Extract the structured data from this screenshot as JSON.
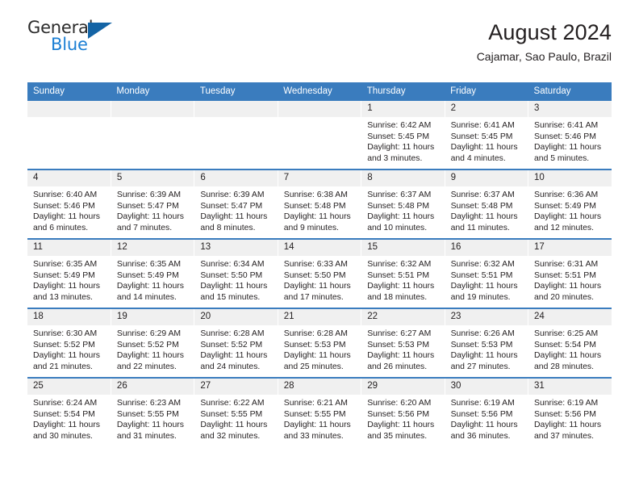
{
  "brand": {
    "name_part1": "General",
    "name_part2": "Blue",
    "triangle_color": "#1464a5",
    "blue": "#1b7fd4"
  },
  "header": {
    "title": "August 2024",
    "subtitle": "Cajamar, Sao Paulo, Brazil"
  },
  "theme": {
    "header_blue": "#3a7cbe",
    "daynum_bg": "#f0f0f0",
    "text": "#231f20"
  },
  "weekdays": [
    "Sunday",
    "Monday",
    "Tuesday",
    "Wednesday",
    "Thursday",
    "Friday",
    "Saturday"
  ],
  "weeks": [
    [
      {
        "day": "",
        "empty": true,
        "sunrise": "",
        "sunset": "",
        "daylight_line1": "",
        "daylight_line2": ""
      },
      {
        "day": "",
        "empty": true,
        "sunrise": "",
        "sunset": "",
        "daylight_line1": "",
        "daylight_line2": ""
      },
      {
        "day": "",
        "empty": true,
        "sunrise": "",
        "sunset": "",
        "daylight_line1": "",
        "daylight_line2": ""
      },
      {
        "day": "",
        "empty": true,
        "sunrise": "",
        "sunset": "",
        "daylight_line1": "",
        "daylight_line2": ""
      },
      {
        "day": "1",
        "sunrise": "Sunrise: 6:42 AM",
        "sunset": "Sunset: 5:45 PM",
        "daylight_line1": "Daylight: 11 hours",
        "daylight_line2": "and 3 minutes."
      },
      {
        "day": "2",
        "sunrise": "Sunrise: 6:41 AM",
        "sunset": "Sunset: 5:45 PM",
        "daylight_line1": "Daylight: 11 hours",
        "daylight_line2": "and 4 minutes."
      },
      {
        "day": "3",
        "sunrise": "Sunrise: 6:41 AM",
        "sunset": "Sunset: 5:46 PM",
        "daylight_line1": "Daylight: 11 hours",
        "daylight_line2": "and 5 minutes."
      }
    ],
    [
      {
        "day": "4",
        "sunrise": "Sunrise: 6:40 AM",
        "sunset": "Sunset: 5:46 PM",
        "daylight_line1": "Daylight: 11 hours",
        "daylight_line2": "and 6 minutes."
      },
      {
        "day": "5",
        "sunrise": "Sunrise: 6:39 AM",
        "sunset": "Sunset: 5:47 PM",
        "daylight_line1": "Daylight: 11 hours",
        "daylight_line2": "and 7 minutes."
      },
      {
        "day": "6",
        "sunrise": "Sunrise: 6:39 AM",
        "sunset": "Sunset: 5:47 PM",
        "daylight_line1": "Daylight: 11 hours",
        "daylight_line2": "and 8 minutes."
      },
      {
        "day": "7",
        "sunrise": "Sunrise: 6:38 AM",
        "sunset": "Sunset: 5:48 PM",
        "daylight_line1": "Daylight: 11 hours",
        "daylight_line2": "and 9 minutes."
      },
      {
        "day": "8",
        "sunrise": "Sunrise: 6:37 AM",
        "sunset": "Sunset: 5:48 PM",
        "daylight_line1": "Daylight: 11 hours",
        "daylight_line2": "and 10 minutes."
      },
      {
        "day": "9",
        "sunrise": "Sunrise: 6:37 AM",
        "sunset": "Sunset: 5:48 PM",
        "daylight_line1": "Daylight: 11 hours",
        "daylight_line2": "and 11 minutes."
      },
      {
        "day": "10",
        "sunrise": "Sunrise: 6:36 AM",
        "sunset": "Sunset: 5:49 PM",
        "daylight_line1": "Daylight: 11 hours",
        "daylight_line2": "and 12 minutes."
      }
    ],
    [
      {
        "day": "11",
        "sunrise": "Sunrise: 6:35 AM",
        "sunset": "Sunset: 5:49 PM",
        "daylight_line1": "Daylight: 11 hours",
        "daylight_line2": "and 13 minutes."
      },
      {
        "day": "12",
        "sunrise": "Sunrise: 6:35 AM",
        "sunset": "Sunset: 5:49 PM",
        "daylight_line1": "Daylight: 11 hours",
        "daylight_line2": "and 14 minutes."
      },
      {
        "day": "13",
        "sunrise": "Sunrise: 6:34 AM",
        "sunset": "Sunset: 5:50 PM",
        "daylight_line1": "Daylight: 11 hours",
        "daylight_line2": "and 15 minutes."
      },
      {
        "day": "14",
        "sunrise": "Sunrise: 6:33 AM",
        "sunset": "Sunset: 5:50 PM",
        "daylight_line1": "Daylight: 11 hours",
        "daylight_line2": "and 17 minutes."
      },
      {
        "day": "15",
        "sunrise": "Sunrise: 6:32 AM",
        "sunset": "Sunset: 5:51 PM",
        "daylight_line1": "Daylight: 11 hours",
        "daylight_line2": "and 18 minutes."
      },
      {
        "day": "16",
        "sunrise": "Sunrise: 6:32 AM",
        "sunset": "Sunset: 5:51 PM",
        "daylight_line1": "Daylight: 11 hours",
        "daylight_line2": "and 19 minutes."
      },
      {
        "day": "17",
        "sunrise": "Sunrise: 6:31 AM",
        "sunset": "Sunset: 5:51 PM",
        "daylight_line1": "Daylight: 11 hours",
        "daylight_line2": "and 20 minutes."
      }
    ],
    [
      {
        "day": "18",
        "sunrise": "Sunrise: 6:30 AM",
        "sunset": "Sunset: 5:52 PM",
        "daylight_line1": "Daylight: 11 hours",
        "daylight_line2": "and 21 minutes."
      },
      {
        "day": "19",
        "sunrise": "Sunrise: 6:29 AM",
        "sunset": "Sunset: 5:52 PM",
        "daylight_line1": "Daylight: 11 hours",
        "daylight_line2": "and 22 minutes."
      },
      {
        "day": "20",
        "sunrise": "Sunrise: 6:28 AM",
        "sunset": "Sunset: 5:52 PM",
        "daylight_line1": "Daylight: 11 hours",
        "daylight_line2": "and 24 minutes."
      },
      {
        "day": "21",
        "sunrise": "Sunrise: 6:28 AM",
        "sunset": "Sunset: 5:53 PM",
        "daylight_line1": "Daylight: 11 hours",
        "daylight_line2": "and 25 minutes."
      },
      {
        "day": "22",
        "sunrise": "Sunrise: 6:27 AM",
        "sunset": "Sunset: 5:53 PM",
        "daylight_line1": "Daylight: 11 hours",
        "daylight_line2": "and 26 minutes."
      },
      {
        "day": "23",
        "sunrise": "Sunrise: 6:26 AM",
        "sunset": "Sunset: 5:53 PM",
        "daylight_line1": "Daylight: 11 hours",
        "daylight_line2": "and 27 minutes."
      },
      {
        "day": "24",
        "sunrise": "Sunrise: 6:25 AM",
        "sunset": "Sunset: 5:54 PM",
        "daylight_line1": "Daylight: 11 hours",
        "daylight_line2": "and 28 minutes."
      }
    ],
    [
      {
        "day": "25",
        "sunrise": "Sunrise: 6:24 AM",
        "sunset": "Sunset: 5:54 PM",
        "daylight_line1": "Daylight: 11 hours",
        "daylight_line2": "and 30 minutes."
      },
      {
        "day": "26",
        "sunrise": "Sunrise: 6:23 AM",
        "sunset": "Sunset: 5:55 PM",
        "daylight_line1": "Daylight: 11 hours",
        "daylight_line2": "and 31 minutes."
      },
      {
        "day": "27",
        "sunrise": "Sunrise: 6:22 AM",
        "sunset": "Sunset: 5:55 PM",
        "daylight_line1": "Daylight: 11 hours",
        "daylight_line2": "and 32 minutes."
      },
      {
        "day": "28",
        "sunrise": "Sunrise: 6:21 AM",
        "sunset": "Sunset: 5:55 PM",
        "daylight_line1": "Daylight: 11 hours",
        "daylight_line2": "and 33 minutes."
      },
      {
        "day": "29",
        "sunrise": "Sunrise: 6:20 AM",
        "sunset": "Sunset: 5:56 PM",
        "daylight_line1": "Daylight: 11 hours",
        "daylight_line2": "and 35 minutes."
      },
      {
        "day": "30",
        "sunrise": "Sunrise: 6:19 AM",
        "sunset": "Sunset: 5:56 PM",
        "daylight_line1": "Daylight: 11 hours",
        "daylight_line2": "and 36 minutes."
      },
      {
        "day": "31",
        "sunrise": "Sunrise: 6:19 AM",
        "sunset": "Sunset: 5:56 PM",
        "daylight_line1": "Daylight: 11 hours",
        "daylight_line2": "and 37 minutes."
      }
    ]
  ]
}
